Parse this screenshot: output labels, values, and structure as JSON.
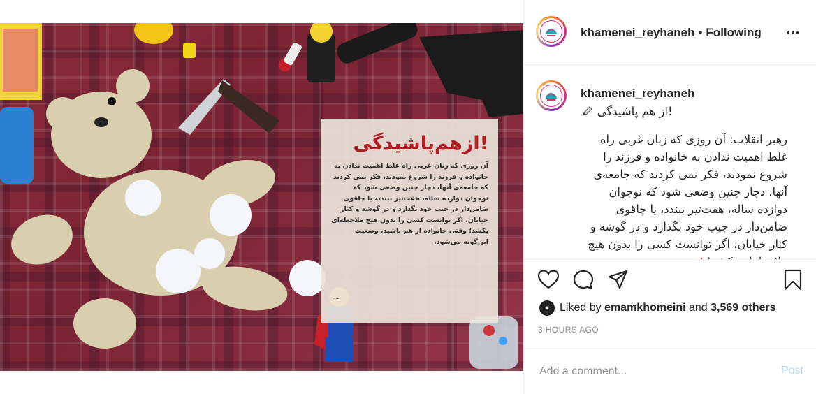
{
  "post_image": {
    "card_title": "!ازهم‌پاشیدگی",
    "card_body": "آن روزی که زنان غربی راه غلط اهمیت ندادن به خانواده و فرزند را شروع نمودند، فکر نمی کردند که جامعه‌ی آنها، دچار چنین وضعی شود که نوجوان دوازده ساله، هفت‌تیر ببندد، یا چاقوی ضامن‌دار در جیب خود بگذارد و در گوشه و کنار خیابان، اگر توانست کسی را بدون هیچ ملاحظه‌ای بکشد؛ وقتی خانواده از هم پاشید، وضعیت این‌گونه می‌شود."
  },
  "header": {
    "username": "khamenei_reyhaneh",
    "separator": "•",
    "follow_status": "Following",
    "more_icon": "more-horizontal-icon"
  },
  "caption": {
    "username": "khamenei_reyhaneh",
    "title_line": "!از هم پاشیدگی",
    "title_emoji": "pencil-icon",
    "body": "رهبر انقلاب: آن روزی که زنان غربی راه غلط اهمیت ندادن به خانواده و فرزند را شروع نمودند، فکر نمی کردند که جامعه‌ی آنها، دچار چنین وضعی شود که نوجوان دوازده ساله، هفت‌تیر ببندد، یا چاقوی ضامن‌دار در جیب خود بگذارد و در گوشه و کنار خیابان، اگر توانست کسی را بدون هیچ ملاحظه‌ای بکشد!",
    "warning_emoji": "red-triangle-icon"
  },
  "actions": {
    "like_icon": "heart-icon",
    "comment_icon": "comment-icon",
    "share_icon": "send-icon",
    "save_icon": "bookmark-icon"
  },
  "likes": {
    "prefix": "Liked by",
    "user": "emamkhomeini",
    "joiner": "and",
    "count": "3,569 others"
  },
  "timestamp": "3 HOURS AGO",
  "comment": {
    "placeholder": "Add a comment...",
    "post_label": "Post"
  },
  "colors": {
    "accent_link": "#b3dbff",
    "card_title_red": "#b01e24",
    "border": "#efefef",
    "muted": "#8e8e8e"
  }
}
